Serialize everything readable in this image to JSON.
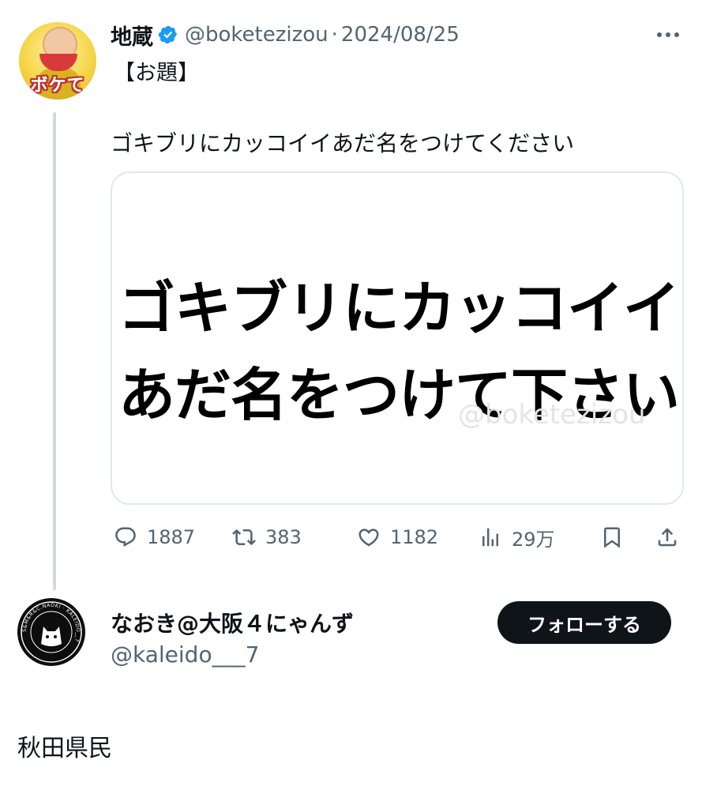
{
  "original_tweet": {
    "author_name": "地蔵",
    "verified": true,
    "handle": "@boketezizou",
    "date_separator": "·",
    "date": "2024/08/25",
    "avatar_logo_text": "ボケて",
    "line1": "【お題】",
    "line2": "ゴキブリにカッコイイあだ名をつけてください",
    "image": {
      "text_line1": "ゴキブリにカッコイイ",
      "text_line2": "あだ名をつけて下さい",
      "watermark": "@boketezizou"
    },
    "actions": {
      "reply_count": "1887",
      "retweet_count": "383",
      "like_count": "1182",
      "view_count": "29万"
    }
  },
  "reply_tweet": {
    "author_name": "なおき@大阪４にゃんず",
    "handle": "@kaleido___7",
    "avatar_ring_text": "S&M&R&C.NAOKI · KALEIDO__7",
    "follow_label": "フォローする",
    "body": "秋田県民"
  },
  "colors": {
    "text_primary": "#0f1419",
    "text_secondary": "#536471",
    "verified_blue": "#1d9bf0",
    "thread_line": "#cfd9de",
    "follow_button_bg": "#0f1419"
  }
}
